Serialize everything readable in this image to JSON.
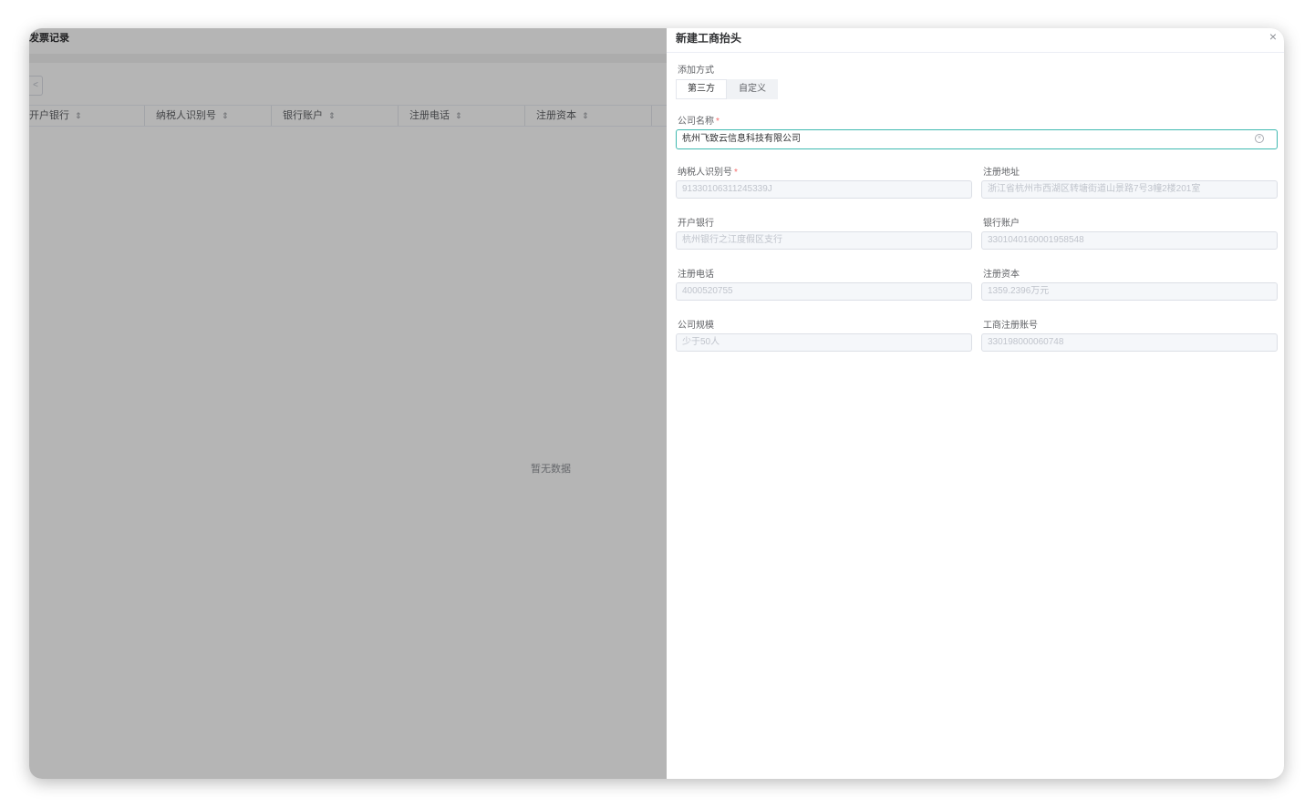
{
  "background": {
    "title": "发票记录",
    "pager_prev": "<",
    "table_headers": [
      "开户银行",
      "纳税人识别号",
      "银行账户",
      "注册电话",
      "注册资本"
    ],
    "empty_text": "暂无数据"
  },
  "drawer": {
    "title": "新建工商抬头",
    "close": "×",
    "add_method_label": "添加方式",
    "tabs": [
      "第三方",
      "自定义"
    ],
    "company_label": "公司名称",
    "required_mark": "*",
    "company_value": "杭州飞致云信息科技有限公司",
    "fields": {
      "taxpayer_id": {
        "label": "纳税人识别号",
        "value": "91330106311245339J"
      },
      "address": {
        "label": "注册地址",
        "value": "浙江省杭州市西湖区转塘街道山景路7号3幢2楼201室"
      },
      "bank": {
        "label": "开户银行",
        "value": "杭州银行之江度假区支行"
      },
      "account": {
        "label": "银行账户",
        "value": "3301040160001958548"
      },
      "phone": {
        "label": "注册电话",
        "value": "4000520755"
      },
      "capital": {
        "label": "注册资本",
        "value": "1359.2396万元"
      },
      "scale": {
        "label": "公司规模",
        "value": "少于50人"
      },
      "reg_no": {
        "label": "工商注册账号",
        "value": "330198000060748"
      }
    }
  }
}
